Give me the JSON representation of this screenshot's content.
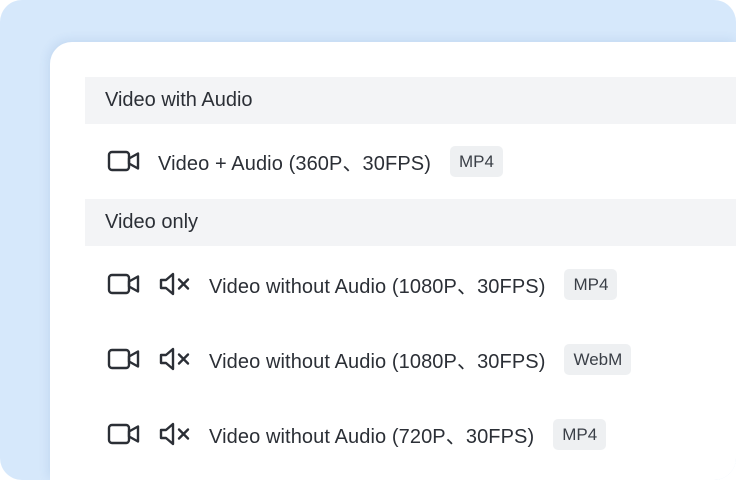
{
  "sections": [
    {
      "title": "Video with Audio",
      "rows": [
        {
          "icons": [
            "video-camera-icon"
          ],
          "label": "Video + Audio (360P、30FPS)",
          "format": "MP4"
        }
      ]
    },
    {
      "title": "Video only",
      "rows": [
        {
          "icons": [
            "video-camera-icon",
            "speaker-muted-icon"
          ],
          "label": "Video without Audio (1080P、30FPS)",
          "format": "MP4"
        },
        {
          "icons": [
            "video-camera-icon",
            "speaker-muted-icon"
          ],
          "label": "Video without Audio (1080P、30FPS)",
          "format": "WebM"
        },
        {
          "icons": [
            "video-camera-icon",
            "speaker-muted-icon"
          ],
          "label": "Video without Audio (720P、30FPS)",
          "format": "MP4"
        }
      ]
    }
  ],
  "colors": {
    "frame_background": "#d6e8fb",
    "card_background": "#ffffff",
    "section_header_background": "#f3f4f6",
    "badge_background": "#eef0f2",
    "text": "#2b2f36"
  }
}
